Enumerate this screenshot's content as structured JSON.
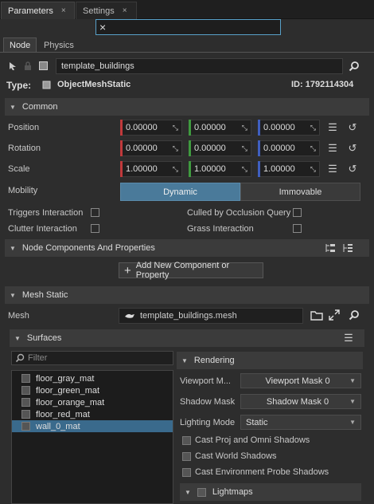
{
  "tabs": [
    {
      "label": "Parameters",
      "close": "×"
    },
    {
      "label": "Settings",
      "close": "×"
    }
  ],
  "search": {
    "value": "",
    "clear_icon": "×"
  },
  "subtabs": [
    "Node",
    "Physics"
  ],
  "node": {
    "name": "template_buildings",
    "type_label": "Type:",
    "type_value": "ObjectMeshStatic",
    "id_label": "ID: 1792114304"
  },
  "common": {
    "title": "Common",
    "rows": [
      {
        "label": "Position",
        "x": "0.00000",
        "y": "0.00000",
        "z": "0.00000"
      },
      {
        "label": "Rotation",
        "x": "0.00000",
        "y": "0.00000",
        "z": "0.00000"
      },
      {
        "label": "Scale",
        "x": "1.00000",
        "y": "1.00000",
        "z": "1.00000"
      }
    ],
    "mobility_label": "Mobility",
    "mobility_options": [
      "Dynamic",
      "Immovable"
    ],
    "flags": [
      {
        "label": "Triggers Interaction"
      },
      {
        "label": "Culled by Occlusion Query"
      },
      {
        "label": "Clutter Interaction"
      },
      {
        "label": "Grass Interaction"
      }
    ]
  },
  "components": {
    "title": "Node Components And Properties",
    "add_button": "Add New Component or Property"
  },
  "mesh_static": {
    "title": "Mesh Static",
    "mesh_label": "Mesh",
    "mesh_value": "template_buildings.mesh"
  },
  "surfaces": {
    "title": "Surfaces",
    "filter_placeholder": "Filter",
    "items": [
      "floor_gray_mat",
      "floor_green_mat",
      "floor_orange_mat",
      "floor_red_mat",
      "wall_0_mat"
    ],
    "selected_index": 4
  },
  "rendering": {
    "title": "Rendering",
    "viewport_label": "Viewport M...",
    "viewport_value": "Viewport Mask 0",
    "shadow_label": "Shadow Mask",
    "shadow_value": "Shadow Mask 0",
    "lighting_label": "Lighting Mode",
    "lighting_value": "Static",
    "checks": [
      "Cast Proj and Omni Shadows",
      "Cast World Shadows",
      "Cast Environment Probe Shadows"
    ],
    "lightmaps": "Lightmaps"
  },
  "colors": {
    "x_axis": "#c0393b",
    "y_axis": "#3f9a3f",
    "z_axis": "#3f5fc0",
    "accent": "#4a7a9a",
    "selection": "#3a6a8c"
  },
  "icons": [
    "arrow-icon",
    "lock-icon",
    "square-icon",
    "search-icon",
    "hamburger-icon",
    "reset-icon",
    "expand-icon",
    "folder-icon",
    "add-icon",
    "bars-icon",
    "chevron-down-icon"
  ]
}
